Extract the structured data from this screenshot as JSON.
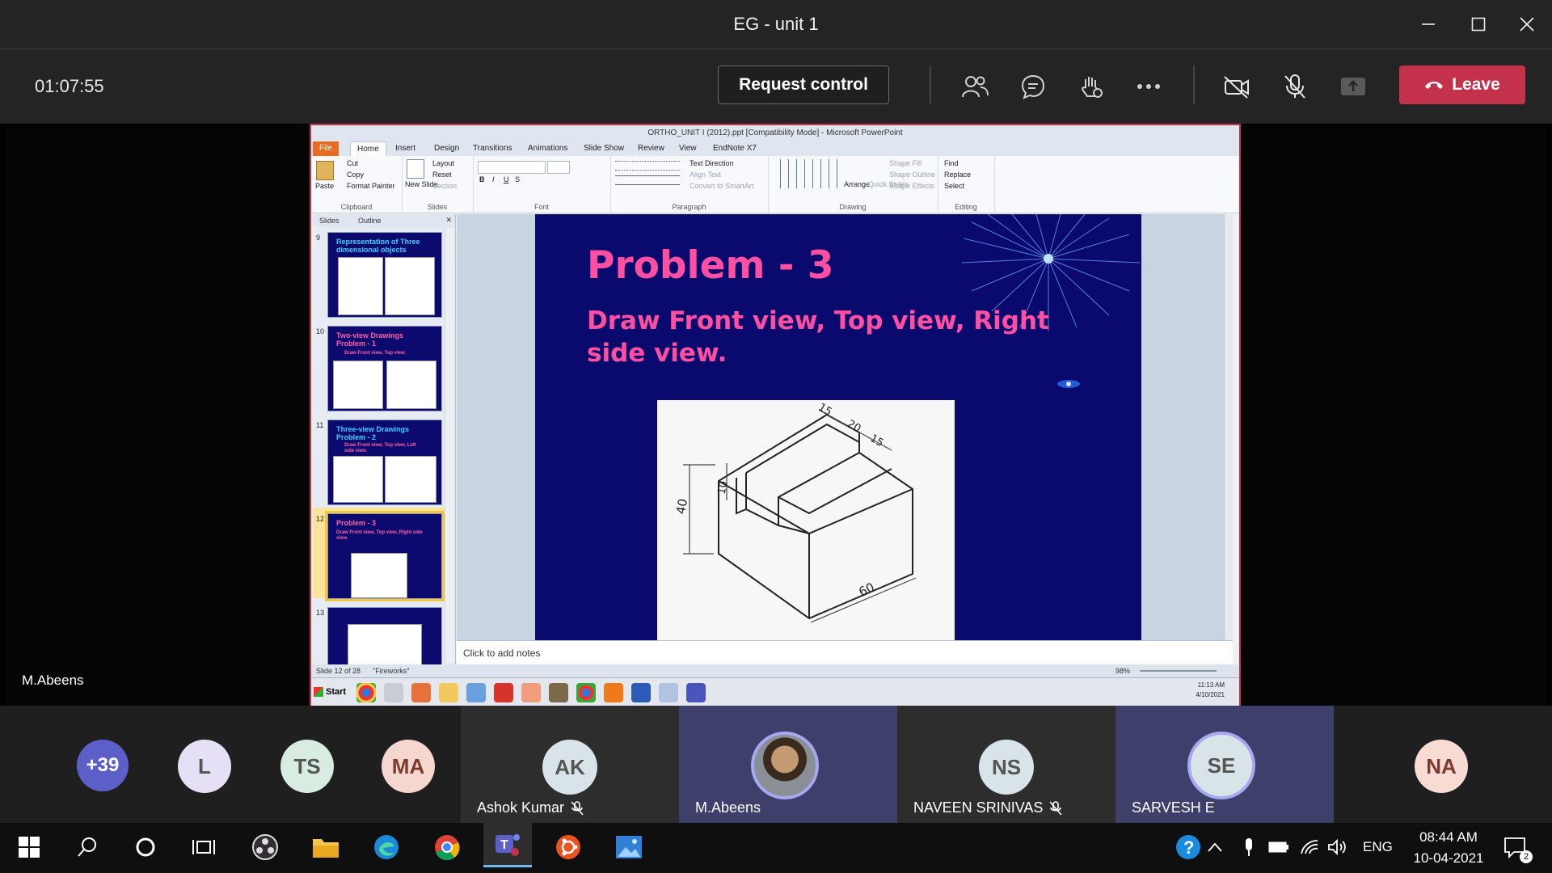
{
  "window": {
    "title": "EG - unit 1"
  },
  "meeting": {
    "elapsed": "01:07:55",
    "request_control_label": "Request control",
    "leave_label": "Leave",
    "presenter_name": "M.Abeens"
  },
  "ppt": {
    "title": "ORTHO_UNIT I (2012).ppt [Compatibility Mode] - Microsoft PowerPoint",
    "tabs": [
      "File",
      "Home",
      "Insert",
      "Design",
      "Transitions",
      "Animations",
      "Slide Show",
      "Review",
      "View",
      "EndNote X7"
    ],
    "ribbon": {
      "clipboard": {
        "label": "Clipboard",
        "paste": "Paste",
        "cut": "Cut",
        "copy": "Copy",
        "format_painter": "Format Painter"
      },
      "slides": {
        "label": "Slides",
        "new_slide": "New Slide",
        "layout": "Layout",
        "reset": "Reset",
        "section": "Section"
      },
      "font": {
        "label": "Font"
      },
      "paragraph": {
        "label": "Paragraph",
        "text_direction": "Text Direction",
        "align_text": "Align Text",
        "convert_smartart": "Convert to SmartArt"
      },
      "drawing": {
        "label": "Drawing",
        "arrange": "Arrange",
        "quick_styles": "Quick Styles",
        "shape_fill": "Shape Fill",
        "shape_outline": "Shape Outline",
        "shape_effects": "Shape Effects"
      },
      "editing": {
        "label": "Editing",
        "find": "Find",
        "replace": "Replace",
        "select": "Select"
      }
    },
    "side_tabs": {
      "slides": "Slides",
      "outline": "Outline"
    },
    "thumbnails": [
      {
        "num": "9",
        "title": "Representation of Three dimensional objects",
        "subtitle": ""
      },
      {
        "num": "10",
        "title": "Two-view Drawings Problem - 1",
        "subtitle": "Draw Front view, Top view."
      },
      {
        "num": "11",
        "title": "Three-view Drawings Problem - 2",
        "subtitle": "Draw Front view, Top view, Left side view."
      },
      {
        "num": "12",
        "title": "Problem - 3",
        "subtitle": "Draw Front view, Top view, Right side view."
      },
      {
        "num": "13",
        "title": "",
        "subtitle": ""
      }
    ],
    "slide": {
      "title": "Problem - 3",
      "subtitle": "Draw Front view, Top view, Right side view.",
      "dims": {
        "d15a": "15",
        "d20": "20",
        "d15b": "15",
        "d10": "10",
        "d40": "40",
        "d60": "60"
      }
    },
    "notes_placeholder": "Click to add notes",
    "status": {
      "slide_info": "Slide 12 of 28",
      "theme": "\"Fireworks\"",
      "zoom": "98%"
    },
    "xp_taskbar": {
      "start": "Start",
      "time": "11:13 AM",
      "date": "4/10/2021"
    }
  },
  "participants": {
    "overflow_count": "+39",
    "list": [
      {
        "initials": "L",
        "name": ""
      },
      {
        "initials": "TS",
        "name": ""
      },
      {
        "initials": "MA",
        "name": ""
      },
      {
        "initials": "AK",
        "name": "Ashok Kumar"
      },
      {
        "initials": "",
        "name": "M.Abeens"
      },
      {
        "initials": "NS",
        "name": "NAVEEN SRINIVAS"
      },
      {
        "initials": "SE",
        "name": "SARVESH E"
      },
      {
        "initials": "NA",
        "name": ""
      }
    ]
  },
  "taskbar": {
    "language": "ENG",
    "time": "08:44 AM",
    "date": "10-04-2021",
    "notification_count": "2"
  },
  "colors": {
    "leave": "#c4314b",
    "slide_bg": "#0a0a6e",
    "slide_text": "#ff4fa3",
    "thumb_title": "#3cd0ff",
    "speaking_tile": "#3e3f6b"
  }
}
